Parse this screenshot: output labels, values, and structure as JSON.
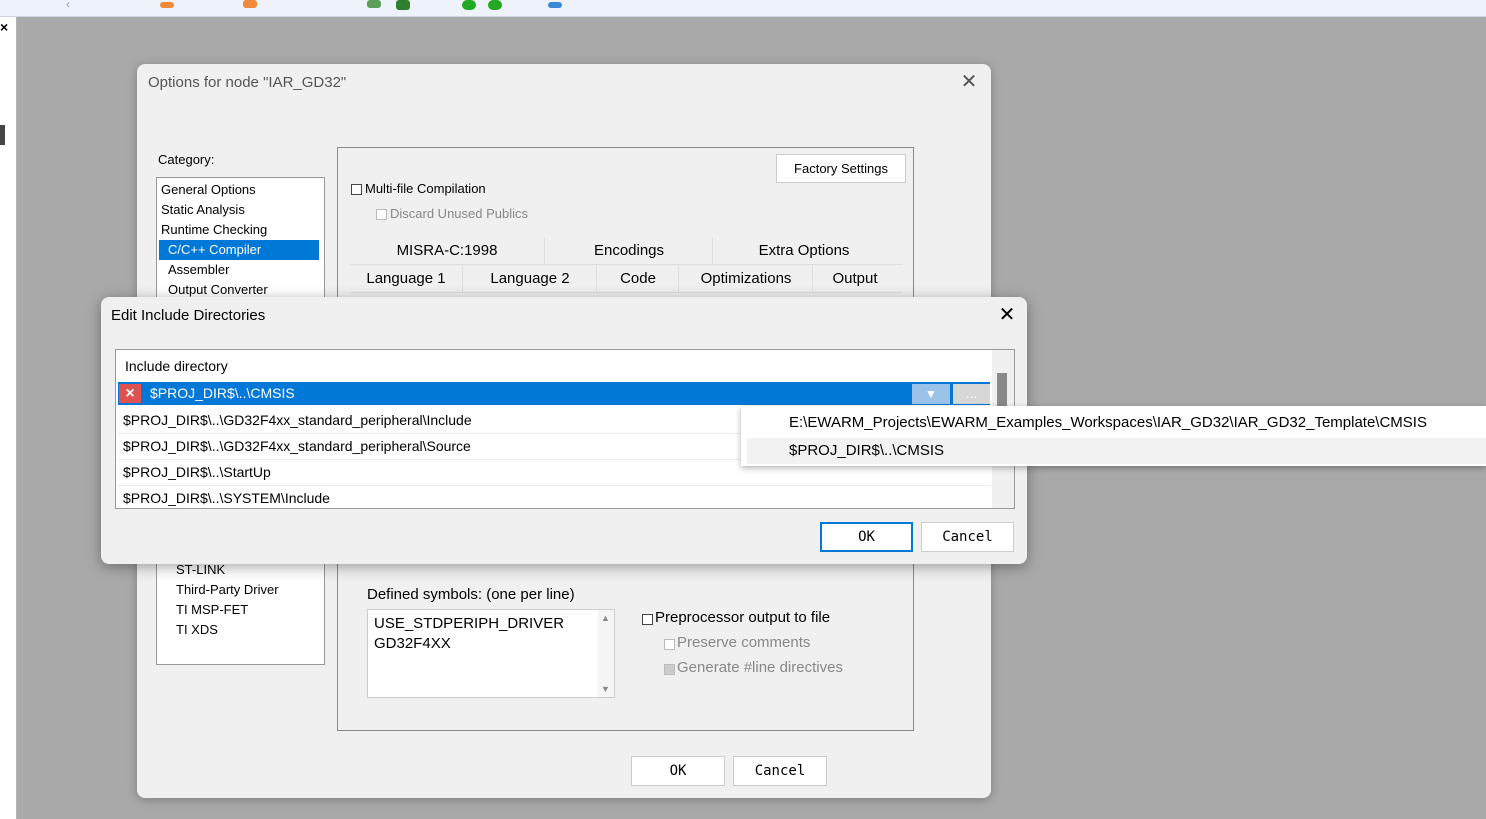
{
  "options_dialog": {
    "title": "Options for node \"IAR_GD32\"",
    "category_label": "Category:",
    "categories": [
      "General Options",
      "Static Analysis",
      "Runtime Checking",
      "C/C++ Compiler",
      "Assembler",
      "Output Converter",
      "ST-LINK",
      "Third-Party Driver",
      "TI MSP-FET",
      "TI XDS"
    ],
    "selected_category": "C/C++ Compiler",
    "factory_settings": "Factory Settings",
    "multi_file": "Multi-file Compilation",
    "discard_unused": "Discard Unused Publics",
    "tabs_row1": [
      "MISRA-C:1998",
      "Encodings",
      "Extra Options"
    ],
    "tabs_row2": [
      "Language 1",
      "Language 2",
      "Code",
      "Optimizations",
      "Output"
    ],
    "defined_symbols_label": "Defined symbols: (one per line)",
    "defined_symbols": [
      "USE_STDPERIPH_DRIVER",
      "GD32F4XX"
    ],
    "preprocessor_output": "Preprocessor output to file",
    "preserve_comments": "Preserve comments",
    "generate_line": "Generate #line directives",
    "ok": "OK",
    "cancel": "Cancel"
  },
  "edit_dialog": {
    "title": "Edit Include Directories",
    "column_header": "Include directory",
    "editing_value": "$PROJ_DIR$\\..\\CMSIS",
    "rows": [
      "$PROJ_DIR$\\..\\GD32F4xx_standard_peripheral\\Include",
      "$PROJ_DIR$\\..\\GD32F4xx_standard_peripheral\\Source",
      "$PROJ_DIR$\\..\\StartUp",
      "$PROJ_DIR$\\..\\SYSTEM\\Include"
    ],
    "dots": "...",
    "ok": "OK",
    "cancel": "Cancel"
  },
  "dropdown_options": [
    "E:\\EWARM_Projects\\EWARM_Examples_Workspaces\\IAR_GD32\\IAR_GD32_Template\\CMSIS",
    "$PROJ_DIR$\\..\\CMSIS"
  ],
  "icons": {
    "close": "close-icon",
    "delete": "delete-icon",
    "dropdown": "chevron-down-icon"
  }
}
